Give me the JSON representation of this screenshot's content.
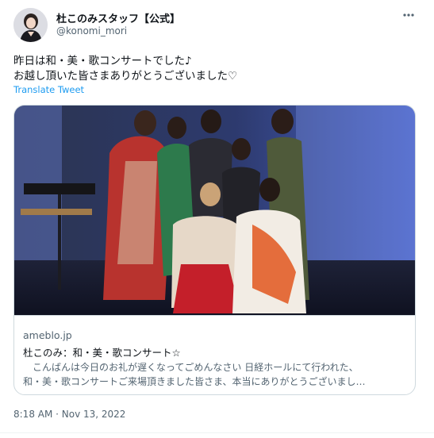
{
  "author": {
    "display_name": "杜このみスタッフ【公式】",
    "handle": "@konomi_mori"
  },
  "more_icon": "more-horizontal-icon",
  "tweet": {
    "text_lines": [
      "昨日は和・美・歌コンサートでした♪",
      "お越し頂いた皆さまありがとうございました♡"
    ],
    "translate_label": "Translate Tweet"
  },
  "link_card": {
    "domain": "ameblo.jp",
    "title": "杜このみ：和・美・歌コンサート☆",
    "description_lines": [
      "　こんばんは今日のお礼が遅くなってごめんなさい 日経ホールにて行われた、",
      "和・美・歌コンサートご来場頂きました皆さま、本当にありがとうございまし…"
    ]
  },
  "timestamp": "8:18 AM · Nov 13, 2022",
  "colors": {
    "link_blue": "#1d9bf0",
    "secondary_text": "#536471",
    "border": "#cfd9de"
  }
}
